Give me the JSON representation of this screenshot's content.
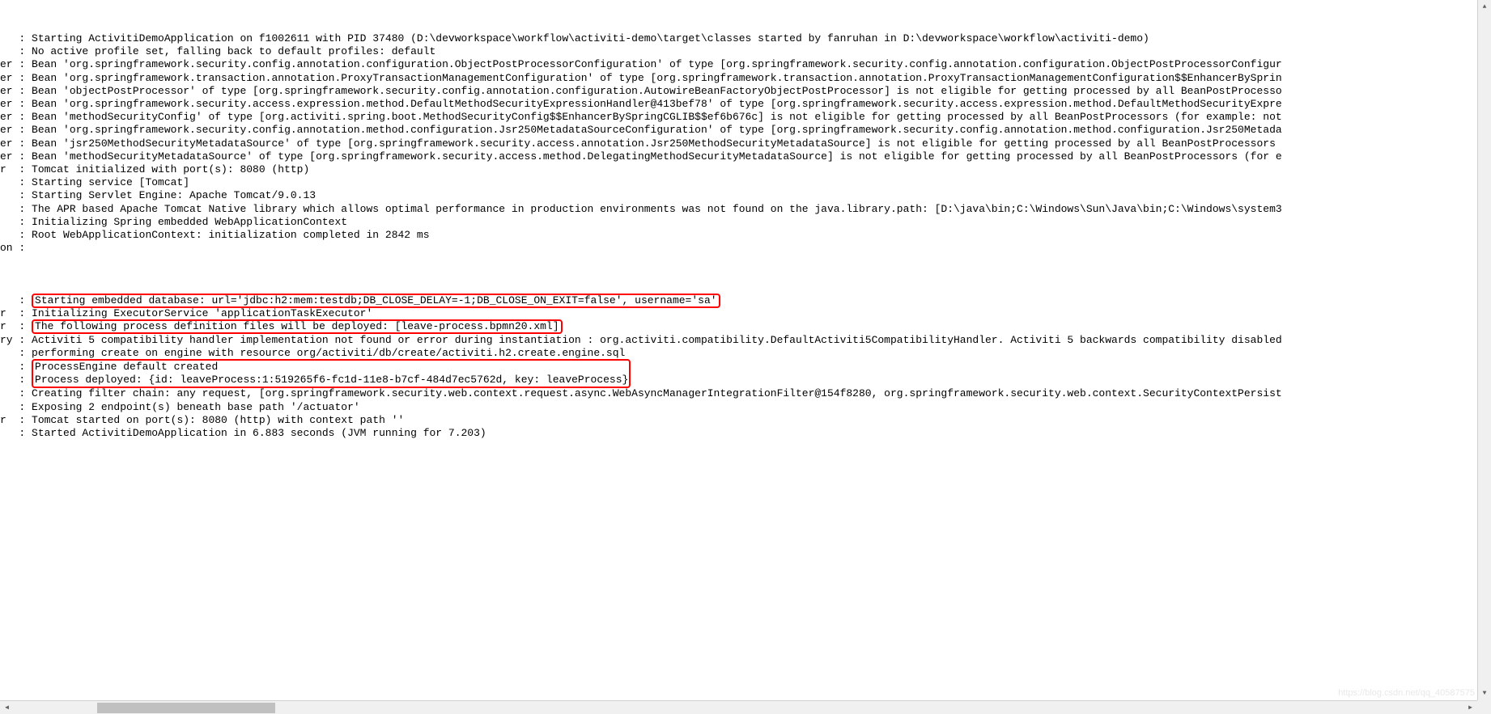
{
  "logs": {
    "line1_prefix": "   : ",
    "line1_text": "Starting ActivitiDemoApplication on f1002611 with PID 37480 (D:\\devworkspace\\workflow\\activiti-demo\\target\\classes started by fanruhan in D:\\devworkspace\\workflow\\activiti-demo)",
    "line2_prefix": "   : ",
    "line2_text": "No active profile set, falling back to default profiles: default",
    "line3_prefix": "er : ",
    "line3_text": "Bean 'org.springframework.security.config.annotation.configuration.ObjectPostProcessorConfiguration' of type [org.springframework.security.config.annotation.configuration.ObjectPostProcessorConfigur",
    "line4_prefix": "er : ",
    "line4_text": "Bean 'org.springframework.transaction.annotation.ProxyTransactionManagementConfiguration' of type [org.springframework.transaction.annotation.ProxyTransactionManagementConfiguration$$EnhancerBySprin",
    "line5_prefix": "er : ",
    "line5_text": "Bean 'objectPostProcessor' of type [org.springframework.security.config.annotation.configuration.AutowireBeanFactoryObjectPostProcessor] is not eligible for getting processed by all BeanPostProcesso",
    "line6_prefix": "er : ",
    "line6_text": "Bean 'org.springframework.security.access.expression.method.DefaultMethodSecurityExpressionHandler@413bef78' of type [org.springframework.security.access.expression.method.DefaultMethodSecurityExpre",
    "line7_prefix": "er : ",
    "line7_text": "Bean 'methodSecurityConfig' of type [org.activiti.spring.boot.MethodSecurityConfig$$EnhancerBySpringCGLIB$$ef6b676c] is not eligible for getting processed by all BeanPostProcessors (for example: not",
    "line8_prefix": "er : ",
    "line8_text": "Bean 'org.springframework.security.config.annotation.method.configuration.Jsr250MetadataSourceConfiguration' of type [org.springframework.security.config.annotation.method.configuration.Jsr250Metada",
    "line9_prefix": "er : ",
    "line9_text": "Bean 'jsr250MethodSecurityMetadataSource' of type [org.springframework.security.access.annotation.Jsr250MethodSecurityMetadataSource] is not eligible for getting processed by all BeanPostProcessors ",
    "line10_prefix": "er : ",
    "line10_text": "Bean 'methodSecurityMetadataSource' of type [org.springframework.security.access.method.DelegatingMethodSecurityMetadataSource] is not eligible for getting processed by all BeanPostProcessors (for e",
    "line11_prefix": "r  : ",
    "line11_text": "Tomcat initialized with port(s): 8080 (http)",
    "line12_prefix": "   : ",
    "line12_text": "Starting service [Tomcat]",
    "line13_prefix": "   : ",
    "line13_text": "Starting Servlet Engine: Apache Tomcat/9.0.13",
    "line14_prefix": "   : ",
    "line14_text": "The APR based Apache Tomcat Native library which allows optimal performance in production environments was not found on the java.library.path: [D:\\java\\bin;C:\\Windows\\Sun\\Java\\bin;C:\\Windows\\system3",
    "line15_prefix": "   : ",
    "line15_text": "Initializing Spring embedded WebApplicationContext",
    "line16_prefix": "   : ",
    "line16_text": "Root WebApplicationContext: initialization completed in 2842 ms",
    "line17_prefix": "on : ",
    "line17_text": "",
    "line18_prefix": "   : ",
    "line18_highlighted": "Starting embedded database: url='jdbc:h2:mem:testdb;DB_CLOSE_DELAY=-1;DB_CLOSE_ON_EXIT=false', username='sa'",
    "line19_prefix": "r  : ",
    "line19_text": "Initializing ExecutorService 'applicationTaskExecutor'",
    "line20_prefix": "r  : ",
    "line20_highlighted": "The following process definition files will be deployed: [leave-process.bpmn20.xml]",
    "line21_prefix": "ry : ",
    "line21_text": "Activiti 5 compatibility handler implementation not found or error during instantiation : org.activiti.compatibility.DefaultActiviti5CompatibilityHandler. Activiti 5 backwards compatibility disabled",
    "line22_prefix": "   : ",
    "line22_text": "performing create on engine with resource org/activiti/db/create/activiti.h2.create.engine.sql",
    "line23_prefix": "   : ",
    "line23_highlighted_a": "ProcessEngine default created",
    "line24_prefix": "   : ",
    "line24_highlighted_b": "Process deployed: {id: leaveProcess:1:519265f6-fc1d-11e8-b7cf-484d7ec5762d, key: leaveProcess}",
    "line25_prefix": "   : ",
    "line25_text": "Creating filter chain: any request, [org.springframework.security.web.context.request.async.WebAsyncManagerIntegrationFilter@154f8280, org.springframework.security.web.context.SecurityContextPersist",
    "line26_prefix": "   : ",
    "line26_text": "Exposing 2 endpoint(s) beneath base path '/actuator'",
    "line27_prefix": "r  : ",
    "line27_text": "Tomcat started on port(s): 8080 (http) with context path ''",
    "line28_prefix": "   : ",
    "line28_text": "Started ActivitiDemoApplication in 6.883 seconds (JVM running for 7.203)"
  },
  "watermark": "https://blog.csdn.net/qq_40587575"
}
